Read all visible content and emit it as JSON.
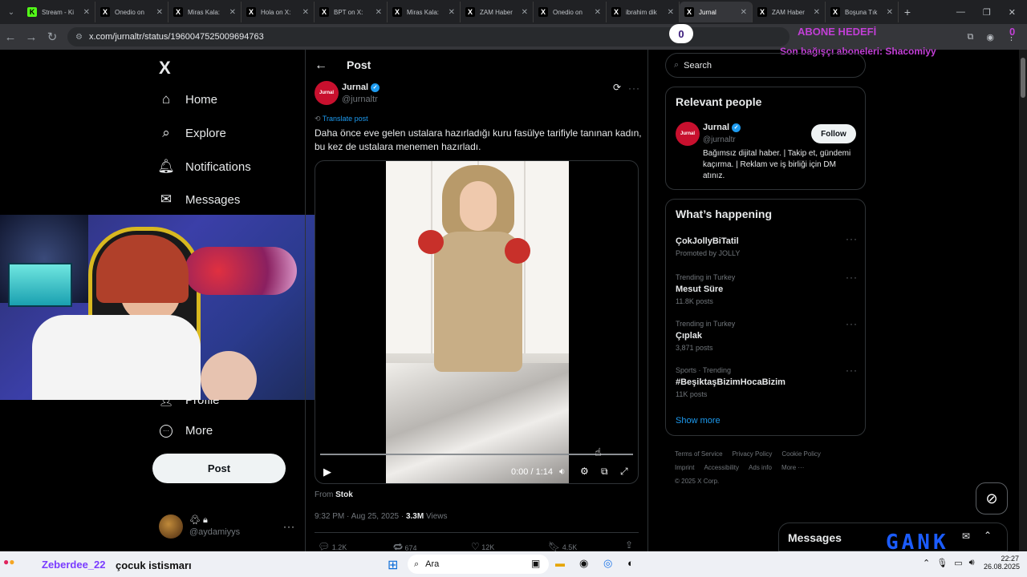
{
  "browser": {
    "tabs": [
      {
        "title": "Stream - Ki",
        "fav": "K",
        "color": "#53fc18"
      },
      {
        "title": "Onedio on",
        "fav": "X",
        "color": "#000"
      },
      {
        "title": "Miras Kala:",
        "fav": "X",
        "color": "#000"
      },
      {
        "title": "Hola on X:",
        "fav": "X",
        "color": "#000"
      },
      {
        "title": "BPT on X:",
        "fav": "X",
        "color": "#000"
      },
      {
        "title": "Miras Kala:",
        "fav": "X",
        "color": "#000"
      },
      {
        "title": "ZAM Haber",
        "fav": "X",
        "color": "#000"
      },
      {
        "title": "Onedio on",
        "fav": "X",
        "color": "#000"
      },
      {
        "title": "ibrahim dik",
        "fav": "X",
        "color": "#000"
      },
      {
        "title": "Jurnal",
        "fav": "X",
        "color": "#000"
      },
      {
        "title": "ZAM Haber",
        "fav": "X",
        "color": "#000"
      },
      {
        "title": "Boşuna Tık",
        "fav": "X",
        "color": "#000"
      }
    ],
    "url": "x.com/jurnaltr/status/1960047525009694763"
  },
  "overlay": {
    "counter": "0",
    "goal_title": "ABONE HEDEFİ",
    "goal_value": "0",
    "last_sub": "Son bağışçı aboneleri: Shacomiyy",
    "chat_user": "Zeberdee_22",
    "chat_msg": "çocuk istismarı",
    "brand": "GANK"
  },
  "sidebar": {
    "logo": "X",
    "items": [
      {
        "label": "Home",
        "icon": "home-icon",
        "glyph": "⌂"
      },
      {
        "label": "Explore",
        "icon": "search-icon",
        "glyph": "⌕"
      },
      {
        "label": "Notifications",
        "icon": "bell-icon",
        "glyph": "🔔︎"
      },
      {
        "label": "Messages",
        "icon": "mail-icon",
        "glyph": "✉"
      }
    ],
    "profile_label": "Profile",
    "more_label": "More",
    "post_label": "Post",
    "account_handle": "@aydamiyys"
  },
  "post": {
    "header_title": "Post",
    "author_name": "Jurnal",
    "author_handle": "@jurnaltr",
    "avatar_text": "Jurnal",
    "translate": "Translate post",
    "text": "Daha önce eve gelen ustalara hazırladığı kuru fasülye tarifiyle tanınan kadın, bu kez de ustalara menemen hazırladı.",
    "video_time": "0:00 / 1:14",
    "video_progress": 0,
    "from_label": "From",
    "from_source": "Stok",
    "timestamp": "9:32 PM · Aug 25, 2025 · ",
    "views_count": "3.3M",
    "views_label": " Views",
    "stats": {
      "replies": "1.2K",
      "reposts": "674",
      "likes": "12K",
      "bookmarks": "4.5K"
    }
  },
  "right": {
    "search_placeholder": "Search",
    "relevant_title": "Relevant people",
    "person_name": "Jurnal",
    "person_handle": "@jurnaltr",
    "follow_label": "Follow",
    "person_bio": "Bağımsız dijital haber. | Takip et, gündemi kaçırma. | Reklam ve iş birliği için DM atınız.",
    "happening_title": "What’s happening",
    "trends": [
      {
        "context": "",
        "name": "ÇokJollyBiTatil",
        "meta": "Promoted by JOLLY"
      },
      {
        "context": "Trending in Turkey",
        "name": "Mesut Süre",
        "meta": "11.8K posts"
      },
      {
        "context": "Trending in Turkey",
        "name": "Çıplak",
        "meta": "3,871 posts"
      },
      {
        "context": "Sports · Trending",
        "name": "#BeşiktaşBizimHocaBizim",
        "meta": "11K posts"
      }
    ],
    "show_more": "Show more",
    "footer": [
      "Terms of Service",
      "Privacy Policy",
      "Cookie Policy",
      "Imprint",
      "Accessibility",
      "Ads info",
      "More ···",
      "© 2025 X Corp."
    ],
    "messages_label": "Messages"
  },
  "taskbar": {
    "search": "Ara",
    "time": "22:27",
    "date": "26.08.2025"
  },
  "colors": {
    "accent": "#1d9bf0",
    "overlay_text": "#c23fd6",
    "jurnal_red": "#c8102e"
  }
}
